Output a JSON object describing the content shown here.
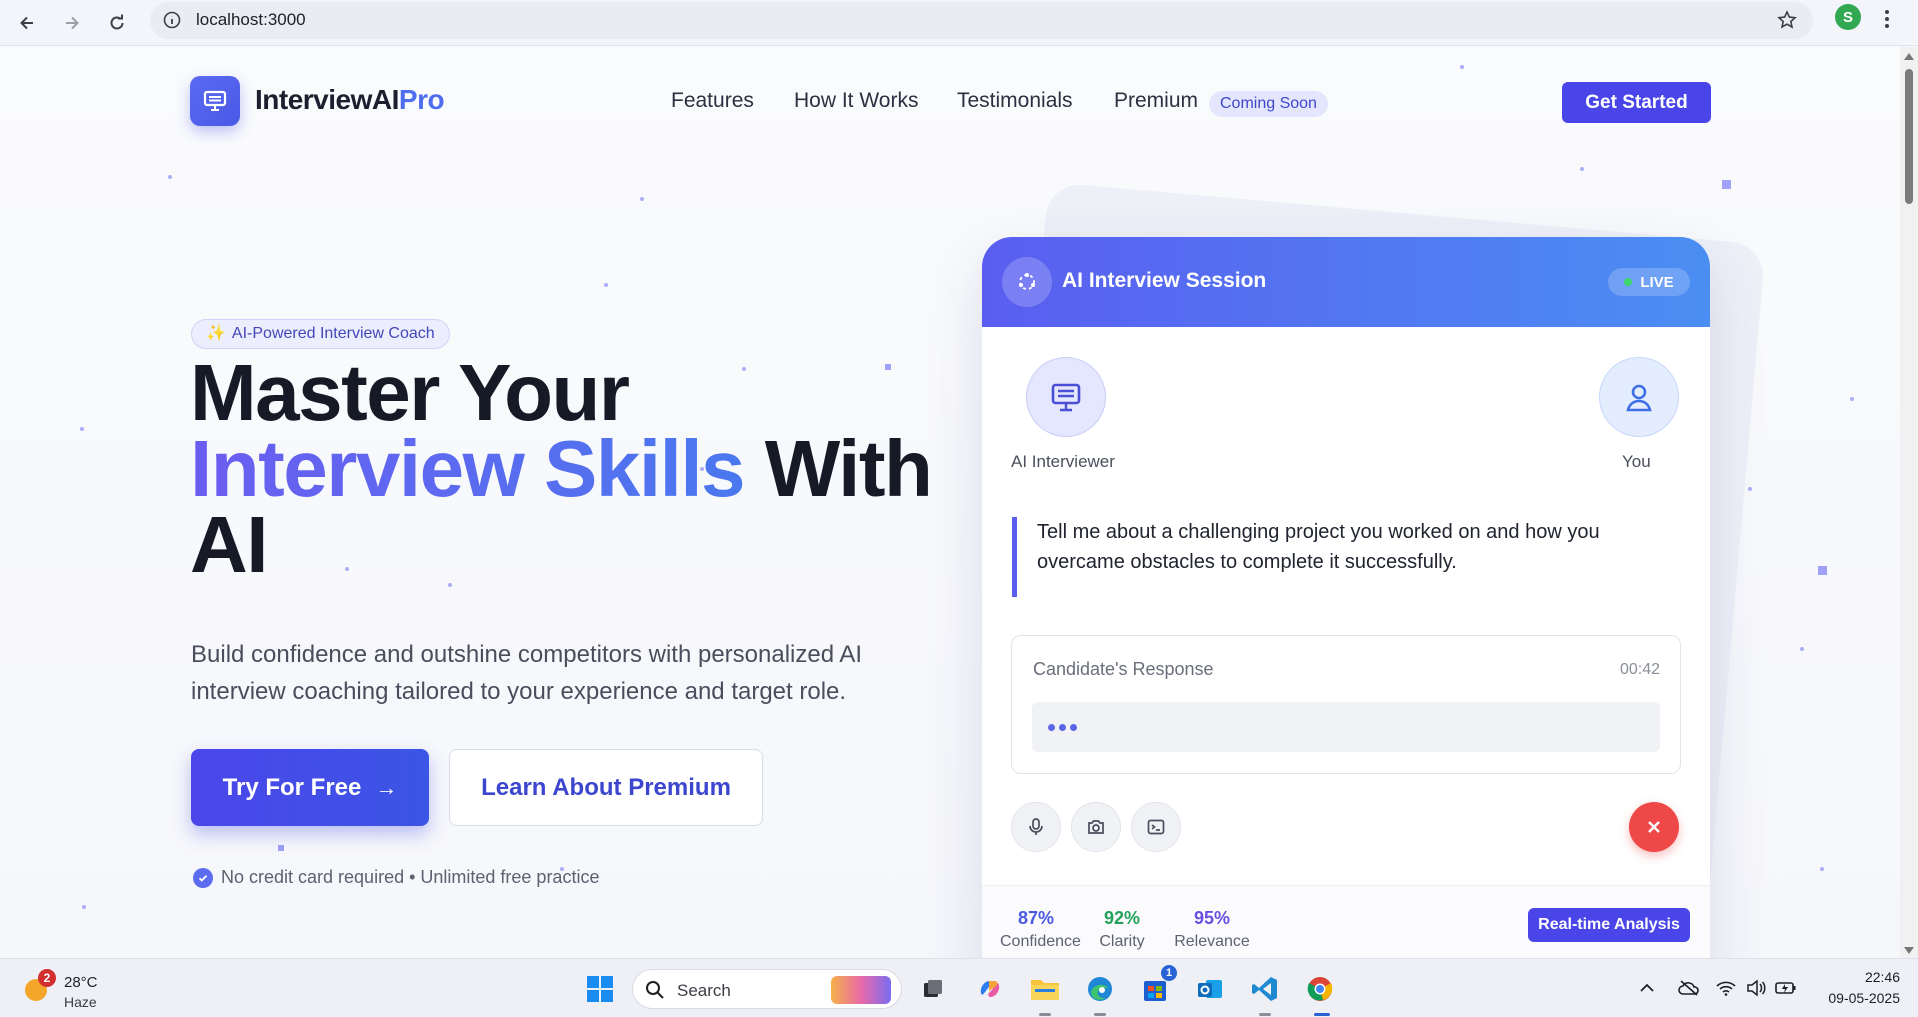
{
  "browser": {
    "url": "localhost:3000",
    "profile_initial": "S"
  },
  "site": {
    "logo_main": "InterviewAI",
    "logo_accent": "Pro",
    "nav": [
      "Features",
      "How It Works",
      "Testimonials",
      "Premium"
    ],
    "coming_soon": "Coming Soon",
    "cta": "Get Started"
  },
  "hero": {
    "badge_spark": "✨",
    "badge": "AI-Powered Interview Coach",
    "title_line1": "Master Your",
    "title_highlight": "Interview Skills",
    "title_with": "With",
    "title_line3": "AI",
    "subtitle": "Build confidence and outshine competitors with personalized AI interview coaching tailored to your experience and target role.",
    "primary_button": "Try For Free",
    "primary_arrow": "→",
    "secondary_button": "Learn About Premium",
    "note": "No credit card required • Unlimited free practice"
  },
  "session": {
    "title": "AI Interview Session",
    "live_label": "LIVE",
    "ai_label": "AI Interviewer",
    "you_label": "You",
    "question": "Tell me about a challenging project you worked on and how you overcame obstacles to complete it successfully.",
    "response_label": "Candidate's Response",
    "response_time": "00:42",
    "metrics": [
      {
        "value": "87%",
        "label": "Confidence",
        "color": "#4a5ae0"
      },
      {
        "value": "92%",
        "label": "Clarity",
        "color": "#23a05a"
      },
      {
        "value": "95%",
        "label": "Relevance",
        "color": "#6a4fe0"
      }
    ],
    "analysis_button": "Real-time Analysis"
  },
  "taskbar": {
    "weather_temp": "28°C",
    "weather_cond": "Haze",
    "weather_badge": "2",
    "search": "Search",
    "store_badge": "1",
    "time": "22:46",
    "date": "09-05-2025"
  },
  "colors": {
    "accent": "#4945e8",
    "brand_gradient_start": "#5a5ef0",
    "brand_gradient_end": "#4b8ef3",
    "danger": "#ee4848"
  }
}
